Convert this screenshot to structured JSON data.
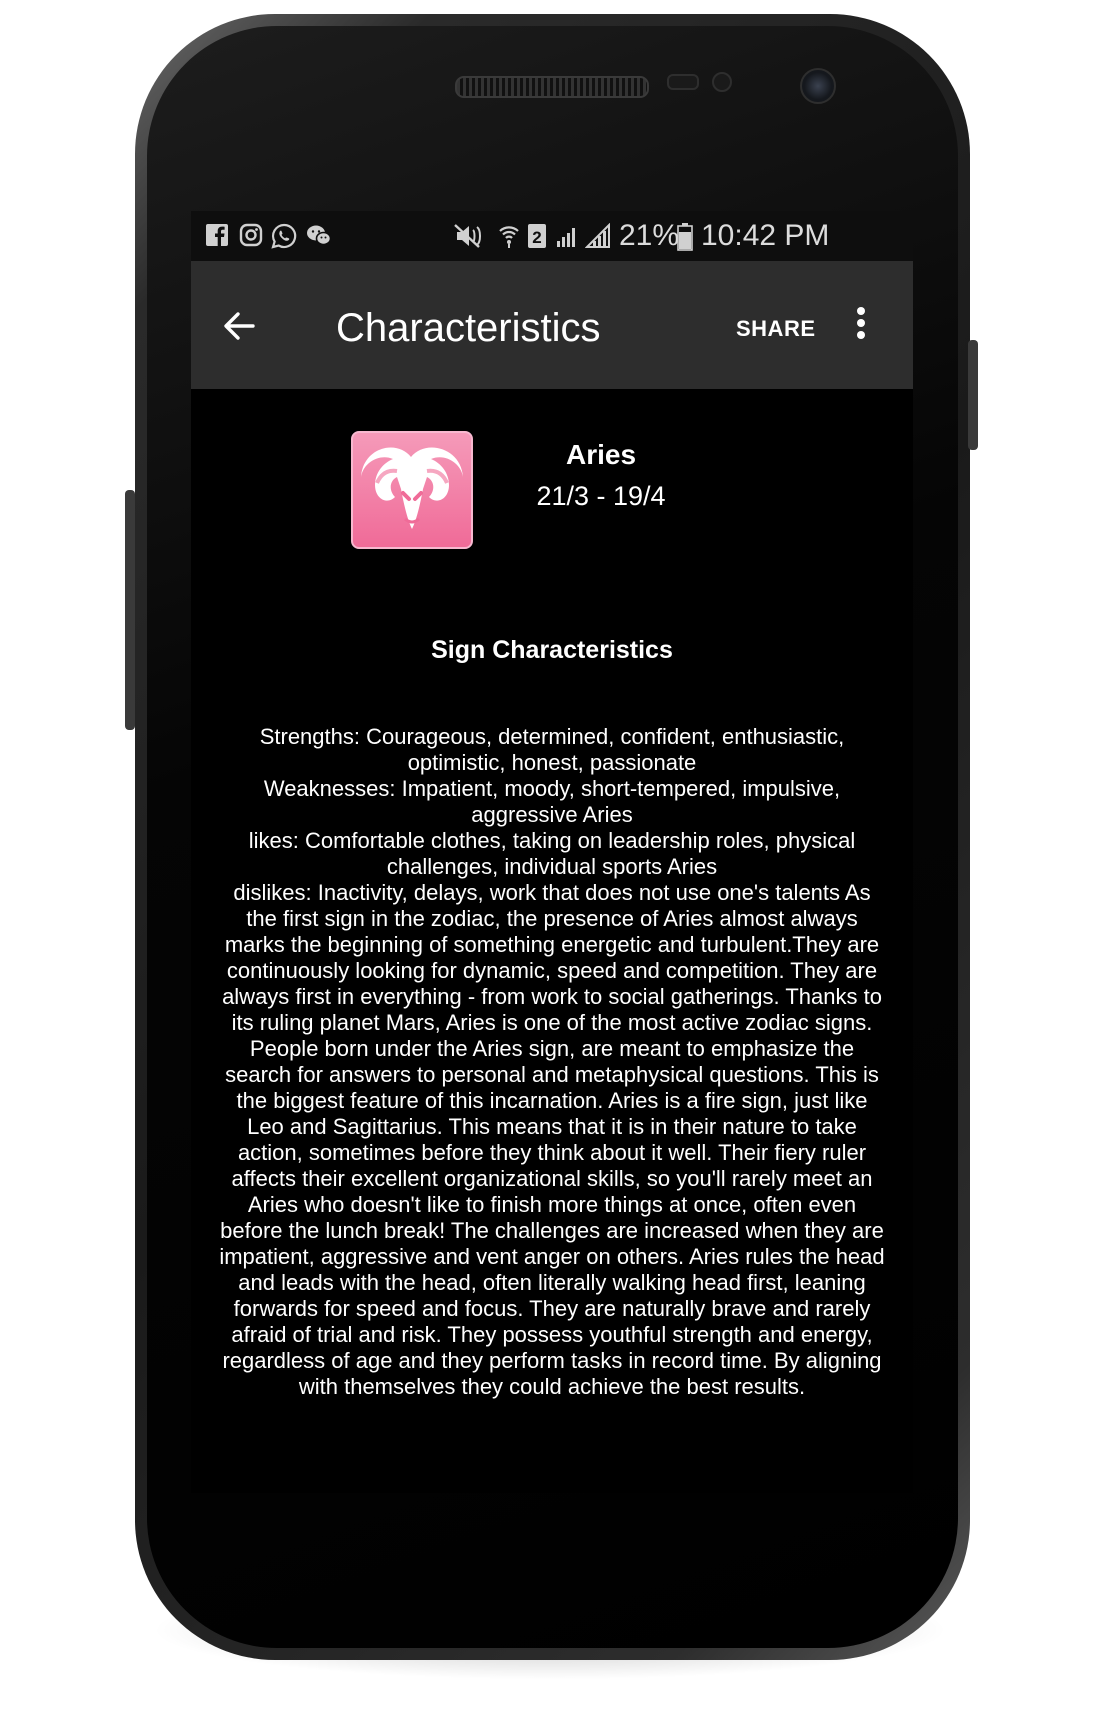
{
  "statusbar": {
    "left_icons": [
      "facebook-icon",
      "instagram-icon",
      "whatsapp-icon",
      "wechat-icon"
    ],
    "right_icons": [
      "mute-icon",
      "wifi-icon",
      "sim-icon",
      "signal-icon"
    ],
    "battery": "21%",
    "time": "10:42 PM"
  },
  "appbar": {
    "back_icon": "arrow-left-icon",
    "title": "Characteristics",
    "share_label": "SHARE",
    "menu_icon": "more-vertical-icon"
  },
  "sign": {
    "icon": "aries-ram-icon",
    "name": "Aries",
    "dates": "21/3 - 19/4"
  },
  "section": {
    "heading": "Sign Characteristics",
    "body": "Strengths: Courageous, determined, confident, enthusiastic, optimistic, honest, passionate\nWeaknesses: Impatient, moody, short-tempered, impulsive, aggressive Aries\nlikes: Comfortable clothes, taking on leadership roles, physical challenges, individual sports Aries\ndislikes: Inactivity, delays, work that does not use one's talents As the first sign in the zodiac, the presence of Aries almost always marks the beginning of something energetic and turbulent.They are continuously looking for dynamic, speed and competition. They are always first in everything - from work to social gatherings. Thanks to its ruling planet Mars, Aries is one of the most active zodiac signs. People born under the Aries sign, are meant to emphasize the search for answers to personal and metaphysical questions. This is the biggest feature of this incarnation. Aries is a fire sign, just like Leo and Sagittarius. This means that it is in their nature to take action, sometimes before they think about it well. Their fiery ruler affects their excellent organizational skills, so you'll rarely meet an Aries who doesn't like to finish more things at once, often even before the lunch break! The challenges are increased when they are impatient, aggressive and vent anger on others. Aries rules the head and leads with the head, often literally walking head first, leaning forwards for speed and focus. They are naturally brave and rarely afraid of trial and risk. They possess youthful strength and energy, regardless of age and they perform tasks in record time. By aligning with themselves they could achieve the best results."
  },
  "colors": {
    "screen_bg": "#000000",
    "appbar_bg": "#2d2d2d",
    "statusbar_bg": "#0e0e0e",
    "sign_icon_pink": "#f06b98",
    "text": "#ffffff"
  }
}
